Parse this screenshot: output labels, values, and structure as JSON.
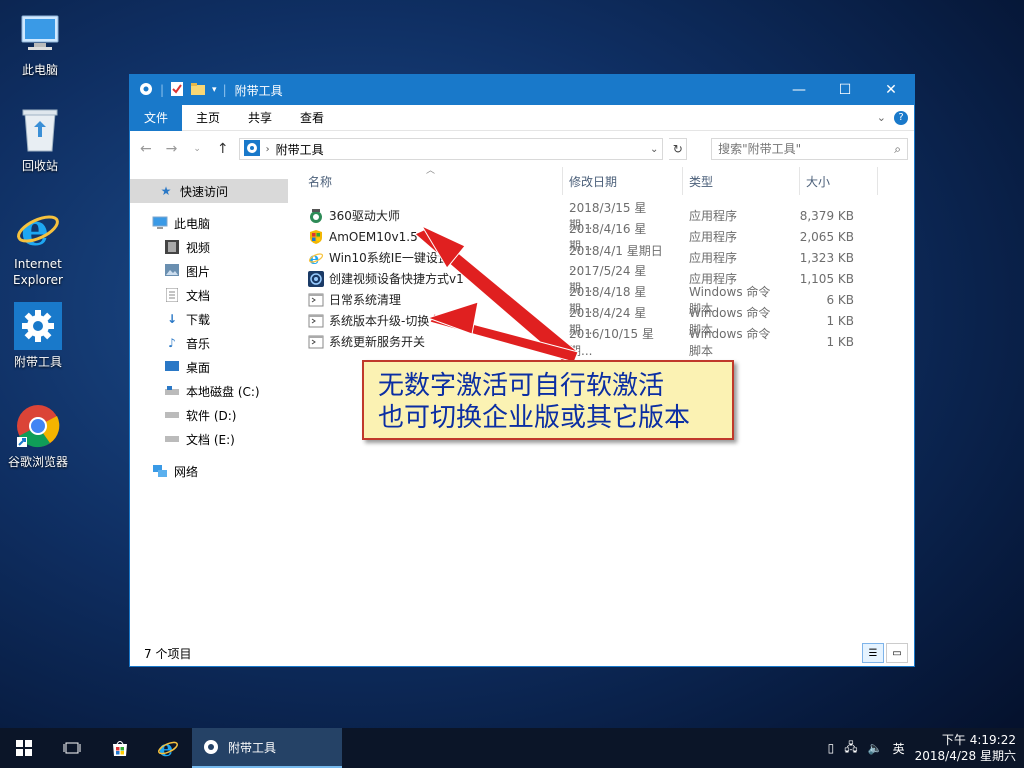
{
  "desktop": {
    "icons": [
      {
        "label": "此电脑",
        "icon": "computer-icon"
      },
      {
        "label": "回收站",
        "icon": "recycle-bin-icon"
      },
      {
        "label": "Internet Explorer",
        "icon": "ie-icon"
      },
      {
        "label": "附带工具",
        "icon": "gear-icon"
      },
      {
        "label": "谷歌浏览器",
        "icon": "chrome-icon"
      }
    ]
  },
  "window": {
    "title": "附带工具",
    "ribbon_tabs": [
      "文件",
      "主页",
      "共享",
      "查看"
    ],
    "address_crumb": "附带工具",
    "search_placeholder": "搜索\"附带工具\"",
    "accent": "#1979ca"
  },
  "navpane": {
    "quick_access": "快速访问",
    "this_pc": "此电脑",
    "items": [
      "视频",
      "图片",
      "文档",
      "下载",
      "音乐",
      "桌面",
      "本地磁盘 (C:)",
      "软件 (D:)",
      "文档 (E:)"
    ],
    "network": "网络"
  },
  "columns": {
    "name": "名称",
    "date": "修改日期",
    "type": "类型",
    "size": "大小"
  },
  "files": [
    {
      "name": "360驱动大师",
      "date": "2018/3/15 星期...",
      "type": "应用程序",
      "size": "8,379 KB",
      "icon": "driver-icon"
    },
    {
      "name": "AmOEM10v1.5",
      "date": "2018/4/16 星期...",
      "type": "应用程序",
      "size": "2,065 KB",
      "icon": "windows-shield-icon"
    },
    {
      "name": "Win10系统IE一键设置",
      "date": "2018/4/1 星期日 ...",
      "type": "应用程序",
      "size": "1,323 KB",
      "icon": "ie-icon"
    },
    {
      "name": "创建视频设备快捷方式v1",
      "date": "2017/5/24 星期...",
      "type": "应用程序",
      "size": "1,105 KB",
      "icon": "video-device-icon"
    },
    {
      "name": "日常系统清理",
      "date": "2018/4/18 星期...",
      "type": "Windows 命令脚本",
      "size": "6 KB",
      "icon": "script-icon"
    },
    {
      "name": "系统版本升级-切换",
      "date": "2018/4/24 星期...",
      "type": "Windows 命令脚本",
      "size": "1 KB",
      "icon": "script-icon"
    },
    {
      "name": "系统更新服务开关",
      "date": "2016/10/15 星期...",
      "type": "Windows 命令脚本",
      "size": "1 KB",
      "icon": "script-icon"
    }
  ],
  "status": {
    "item_count": "7 个项目"
  },
  "annotation": {
    "line1": "无数字激活可自行软激活",
    "line2": "也可切换企业版或其它版本"
  },
  "taskbar": {
    "active_app": "附带工具",
    "ime": "英",
    "time": "下午 4:19:22",
    "date": "2018/4/28 星期六"
  }
}
